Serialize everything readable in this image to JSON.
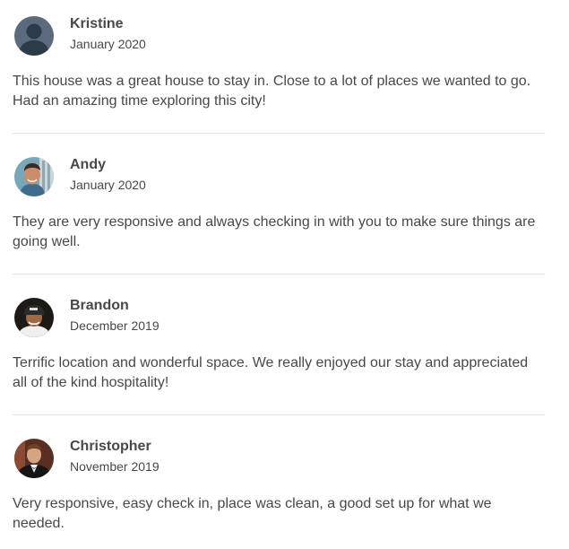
{
  "reviews": [
    {
      "name": "Kristine",
      "date": "January 2020",
      "text": "This house was a great house to stay in. Close to a lot of places we wanted to go. Had an amazing time exploring this city!",
      "avatar_icon": "default-person-avatar-icon"
    },
    {
      "name": "Andy",
      "date": "January 2020",
      "text": "They are very responsive and always checking in with you to make sure things are going well.",
      "avatar_icon": "user-photo-avatar"
    },
    {
      "name": "Brandon",
      "date": "December 2019",
      "text": "Terrific location and wonderful space. We really enjoyed our stay and appreciated all of the kind hospitality!",
      "avatar_icon": "user-photo-avatar"
    },
    {
      "name": "Christopher",
      "date": "November 2019",
      "text": "Very responsive, easy check in, place was clean, a good set up for what we needed.",
      "avatar_icon": "user-photo-avatar"
    }
  ],
  "colors": {
    "text": "#484848",
    "divider": "#e4e4e4",
    "default_avatar_bg": "#5b6b7b"
  }
}
